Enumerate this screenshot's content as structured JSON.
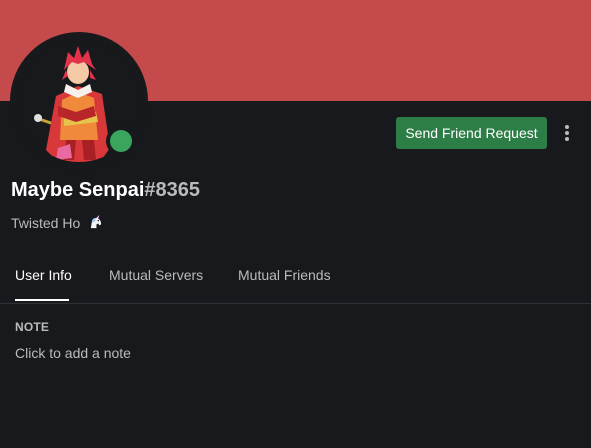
{
  "banner": {
    "color": "#c44a4b"
  },
  "avatar": {
    "icon": "anime-character-avatar",
    "status": "online",
    "status_color": "#3ba55d"
  },
  "actions": {
    "send_friend_request_label": "Send Friend Request",
    "send_friend_request_color": "#2d7d46",
    "more_icon": "more-vertical-icon"
  },
  "user": {
    "name": "Maybe Senpai",
    "discriminator": "#8365"
  },
  "custom_status": {
    "text": "Twisted Ho",
    "emoji": "unicorn-emoji"
  },
  "tabs": [
    {
      "label": "User Info",
      "active": true
    },
    {
      "label": "Mutual Servers",
      "active": false
    },
    {
      "label": "Mutual Friends",
      "active": false
    }
  ],
  "note": {
    "heading": "NOTE",
    "placeholder": "Click to add a note"
  }
}
